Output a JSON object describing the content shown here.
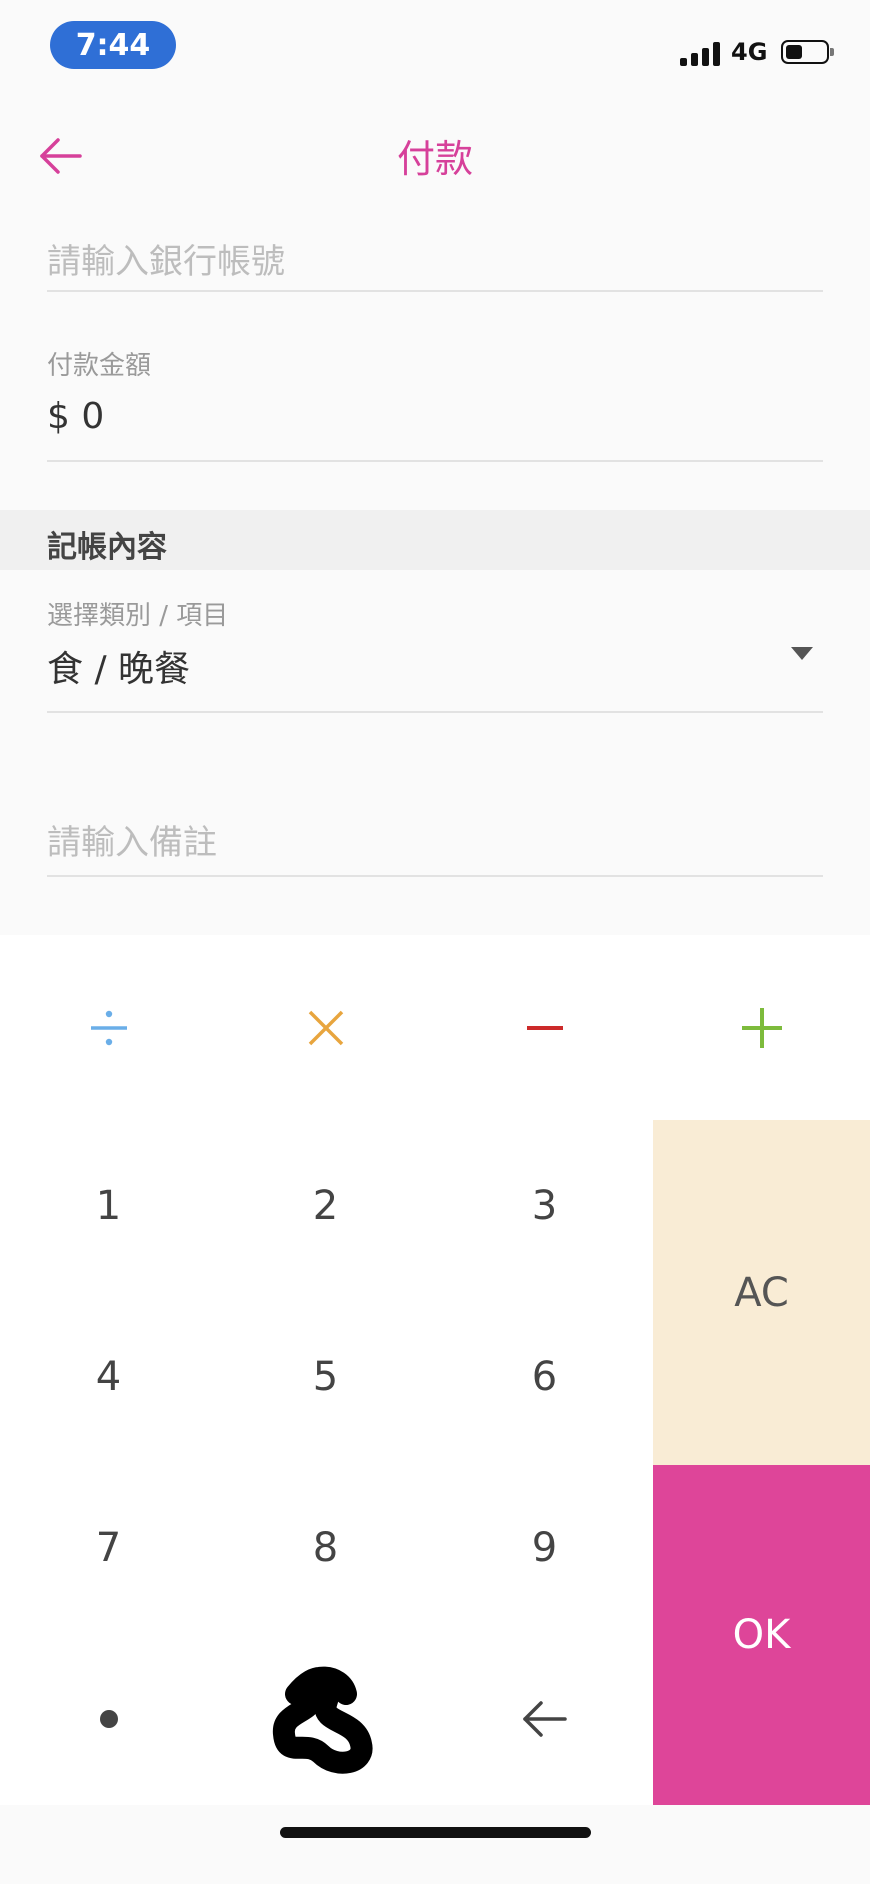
{
  "status_bar": {
    "time": "7:44",
    "network": "4G",
    "icons": [
      "signal-icon",
      "battery-icon"
    ]
  },
  "header": {
    "title": "付款",
    "back_icon": "arrow-left-icon"
  },
  "form": {
    "account_placeholder": "請輸入銀行帳號",
    "amount_label": "付款金額",
    "amount_value": "$ 0",
    "section_title": "記帳內容",
    "category_label": "選擇類別 / 項目",
    "category_value": "食 / 晚餐",
    "note_placeholder": "請輸入備註"
  },
  "keypad": {
    "operators": [
      "÷",
      "×",
      "−",
      "+"
    ],
    "numbers": [
      "1",
      "2",
      "3",
      "4",
      "5",
      "6",
      "7",
      "8",
      "9"
    ],
    "clear_label": "AC",
    "ok_label": "OK",
    "icons": [
      "divide-icon",
      "multiply-icon",
      "minus-icon",
      "plus-icon",
      "dot-icon",
      "backspace-icon"
    ]
  },
  "colors": {
    "accent": "#d6409a",
    "ok_button": "#de4599",
    "ac_button": "#f9ecd5",
    "divide": "#6aaee8",
    "multiply": "#e8a53e",
    "minus": "#cc2a2a",
    "plus": "#7dbb3c"
  }
}
